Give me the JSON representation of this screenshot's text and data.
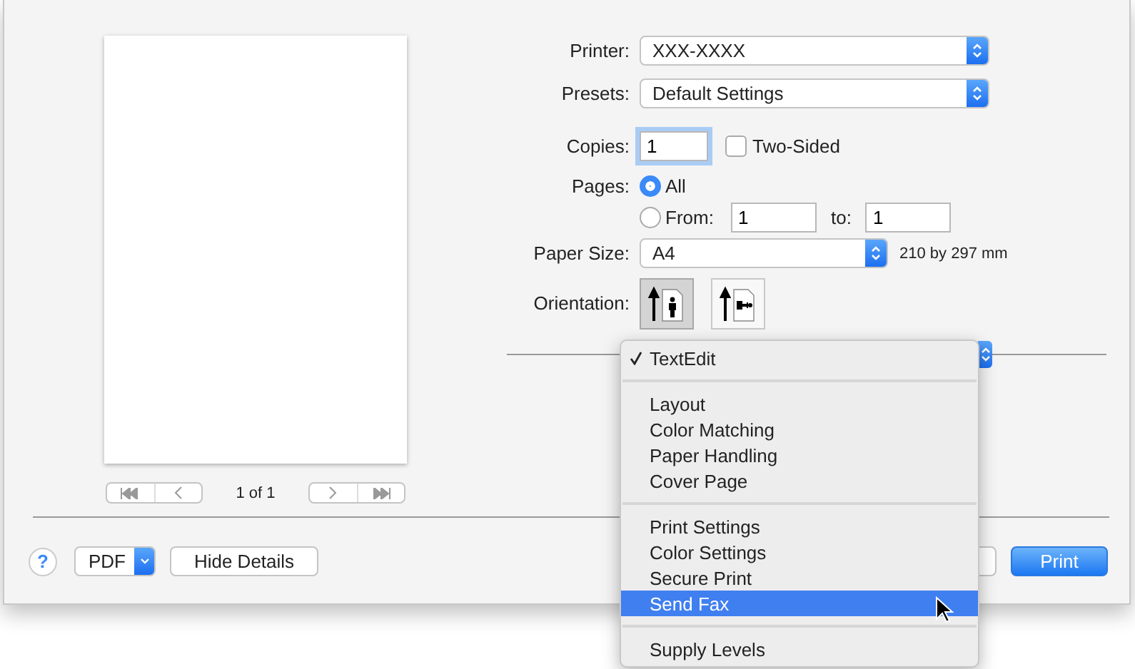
{
  "preview": {
    "page_counter": "1 of 1"
  },
  "form": {
    "printer": {
      "label": "Printer:",
      "value": "XXX-XXXX"
    },
    "presets": {
      "label": "Presets:",
      "value": "Default Settings"
    },
    "copies": {
      "label": "Copies:",
      "value": "1"
    },
    "two_sided": {
      "label": "Two-Sided",
      "checked": false
    },
    "pages": {
      "label": "Pages:",
      "options": [
        {
          "label": "All",
          "selected": true
        },
        {
          "label": "From:",
          "selected": false
        }
      ],
      "from": "1",
      "to_label": "to:",
      "to": "1"
    },
    "paper_size": {
      "label": "Paper Size:",
      "value": "A4",
      "dimensions": "210 by 297 mm"
    },
    "orientation": {
      "label": "Orientation:",
      "options": [
        {
          "kind": "portrait",
          "selected": true
        },
        {
          "kind": "landscape",
          "selected": false
        }
      ]
    }
  },
  "menu": {
    "groups": [
      [
        {
          "label": "TextEdit",
          "checked": true,
          "highlighted": false
        }
      ],
      [
        {
          "label": "Layout",
          "checked": false,
          "highlighted": false
        },
        {
          "label": "Color Matching",
          "checked": false,
          "highlighted": false
        },
        {
          "label": "Paper Handling",
          "checked": false,
          "highlighted": false
        },
        {
          "label": "Cover Page",
          "checked": false,
          "highlighted": false
        }
      ],
      [
        {
          "label": "Print Settings",
          "checked": false,
          "highlighted": false
        },
        {
          "label": "Color Settings",
          "checked": false,
          "highlighted": false
        },
        {
          "label": "Secure Print",
          "checked": false,
          "highlighted": false
        },
        {
          "label": "Send Fax",
          "checked": false,
          "highlighted": true
        }
      ],
      [
        {
          "label": "Supply Levels",
          "checked": false,
          "highlighted": false
        }
      ]
    ]
  },
  "footer": {
    "help": "?",
    "pdf": "PDF",
    "hide_details": "Hide Details",
    "print": "Print"
  }
}
